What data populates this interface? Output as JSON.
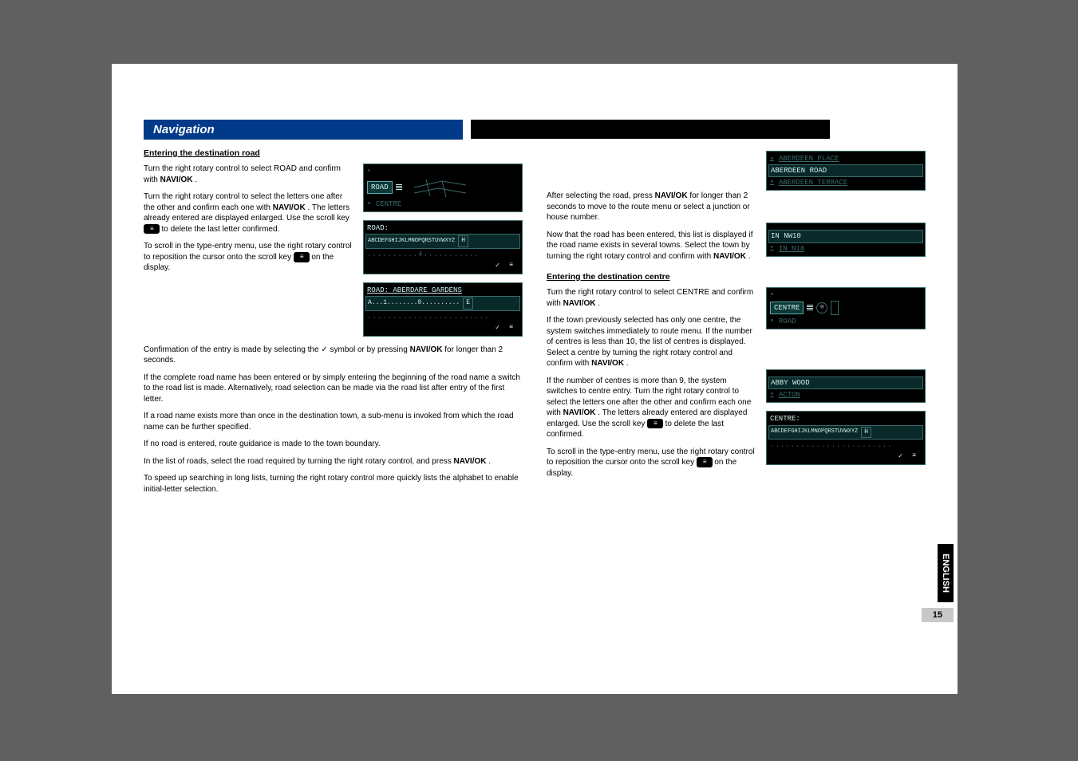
{
  "section_title": "Navigation",
  "page_number": "15",
  "language_tab": "ENGLISH",
  "naviok_label": "NAVI/OK",
  "left": {
    "heading": "Entering the destination road",
    "p1a": "Turn the right rotary control to select ",
    "p1b": "ROAD",
    "p1c": " and confirm with ",
    "p1d": ".",
    "p2a": "Turn the right rotary control to select the letters one after the other and confirm each one with ",
    "p2b": ". The letters already entered are displayed enlarged. Use the scroll key ",
    "p2c": " to delete the last letter confirmed.",
    "p3": "To scroll in the type-entry menu, use the right rotary control to reposition the cursor onto the scroll key ",
    "p3b": " on the display.",
    "p4a": "Confirmation of the entry is made by selecting the ",
    "p4b": " symbol or by pressing ",
    "p4c": " for longer than 2 seconds.",
    "p5": "If the complete road name has been entered or by simply entering the beginning of the road name a switch to the road list is made. Alternatively, road selection can be made via the road list after entry of the first letter.",
    "p6": "If a road name exists more than once in the destination town, a sub-menu is invoked from which the road name can be further specified.",
    "p7": "If no road is entered, route guidance is made to the town boundary.",
    "p8a": "In the list of roads, select the road required by turning the right rotary control, and press ",
    "p8b": ".",
    "p9": "To speed up searching in long lists, turning the right rotary control more quickly lists the alphabet to enable initial-letter selection."
  },
  "right": {
    "p1a": "After selecting the road, press ",
    "p1b": " for longer than 2 seconds to move to the route menu or select a junction or house number.",
    "p2a": "Now that the road has been entered, this list is displayed if the road name exists in several towns. Select the town by turning the right rotary control and confirm with ",
    "p2b": ".",
    "heading2": "Entering the destination centre",
    "p3a": "Turn the right rotary control to select ",
    "p3b": "CENTRE",
    "p3c": " and confirm with ",
    "p3d": ".",
    "p4a": "If the town previously selected has only one centre, the system switches immediately to route menu. If the number of centres is less than 10, the list of centres is displayed. Select a centre by turning the right rotary control and confirm with ",
    "p4b": ".",
    "p5a": "If the number of centres is more than 9, the system switches to centre entry. Turn the right rotary control to select the letters one after the other and confirm each one with ",
    "p5b": ". The letters already entered are displayed enlarged. Use the scroll key ",
    "p5c": " to delete the last confirmed.",
    "p6": "To scroll in the type-entry menu, use the right rotary control to reposition the cursor onto the scroll key ",
    "p6b": " on the display."
  },
  "lcd": {
    "road_sel": "ROAD",
    "centre_below": "CENTRE",
    "road_label": "ROAD:",
    "alpha": "ABCDEFGHIJKLMNOPQRSTUVWXYZ",
    "h_box": "H",
    "dots4": "..........4...........",
    "road_aberdare": "ROAD: ABERDARE GARDENS",
    "a_line": "A...1........0..........",
    "e_box": "E",
    "dots_plain": "........................",
    "aberdeen_place": "ABERDEEN PLACE",
    "aberdeen_road": "ABERDEEN ROAD",
    "aberdeen_terrace": "ABERDEEN TERRACE",
    "in_nw10": "IN NW10",
    "in_n18": "IN N18",
    "centre_sel": "CENTRE",
    "road_below": "ROAD",
    "abby_wood": "ABBY WOOD",
    "acton": "ACTON",
    "centre_label": "CENTRE:"
  }
}
